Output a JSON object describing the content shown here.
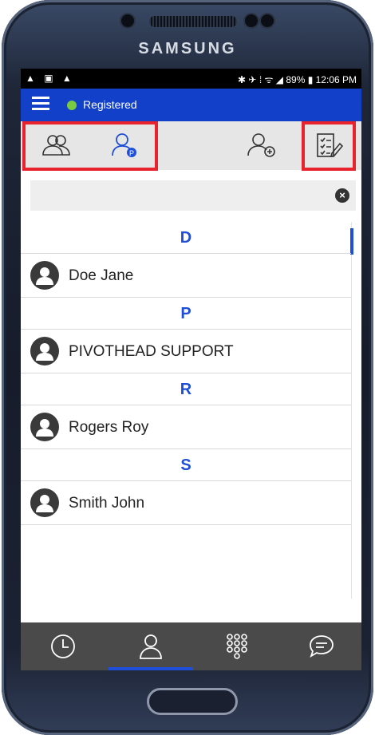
{
  "device": {
    "brand": "SAMSUNG"
  },
  "status_bar": {
    "left_icons": "▲ ▣ ▲",
    "right_text": "✱ ✈ ⁞ ᯤ ◢ 89% ▮ 12:06 PM"
  },
  "app_bar": {
    "status": "Registered"
  },
  "toolbar": {
    "icons": [
      "all-contacts-icon",
      "favorite-contacts-icon",
      "add-contact-icon",
      "select-edit-icon"
    ]
  },
  "search": {
    "placeholder": ""
  },
  "contacts": [
    {
      "letter": "D",
      "name": "Doe Jane"
    },
    {
      "letter": "P",
      "name": "PIVOTHEAD SUPPORT"
    },
    {
      "letter": "R",
      "name": "Rogers Roy"
    },
    {
      "letter": "S",
      "name": "Smith John"
    }
  ],
  "bottom_nav": {
    "items": [
      "history-icon",
      "contacts-icon",
      "dialpad-icon",
      "chat-icon"
    ],
    "active": "contacts-icon"
  },
  "colors": {
    "accent": "#1f4ed8",
    "app_bar": "#1240c8",
    "highlight": "#e8232d",
    "online": "#7ac943"
  }
}
